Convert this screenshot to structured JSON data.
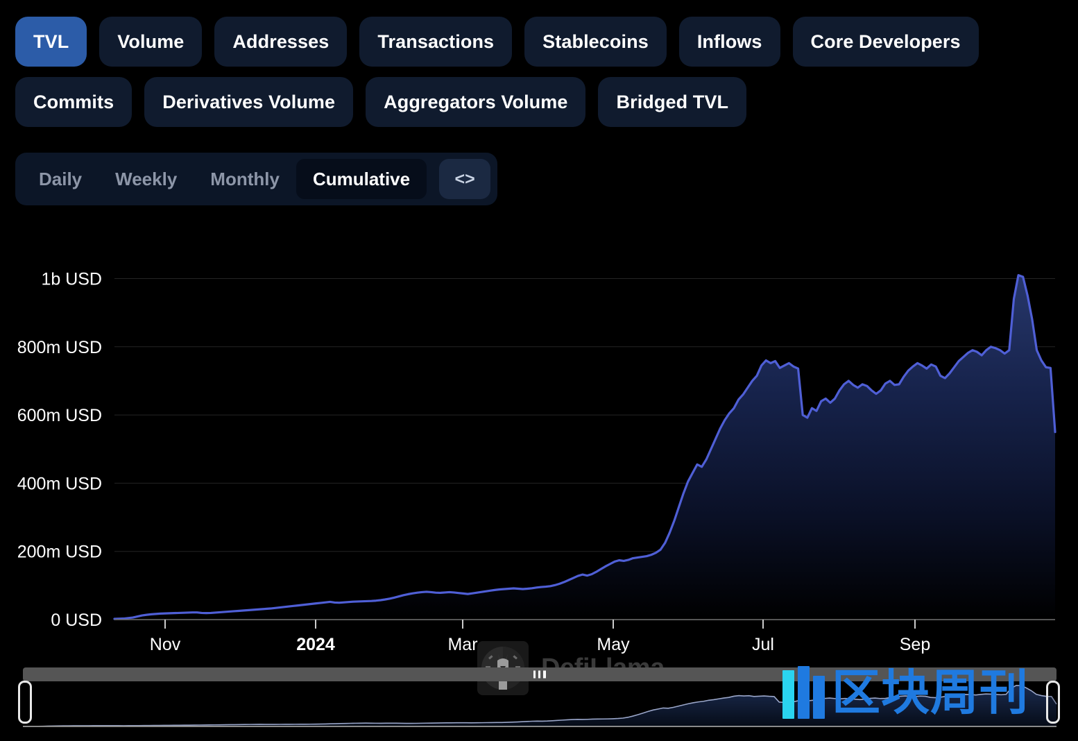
{
  "metric_tabs": {
    "row1": [
      {
        "label": "TVL",
        "active": true
      },
      {
        "label": "Volume",
        "active": false
      },
      {
        "label": "Addresses",
        "active": false
      },
      {
        "label": "Transactions",
        "active": false
      },
      {
        "label": "Stablecoins",
        "active": false
      },
      {
        "label": "Inflows",
        "active": false
      },
      {
        "label": "Core Developers",
        "active": false
      }
    ],
    "row2": [
      {
        "label": "Commits",
        "active": false
      },
      {
        "label": "Derivatives Volume",
        "active": false
      },
      {
        "label": "Aggregators Volume",
        "active": false
      },
      {
        "label": "Bridged TVL",
        "active": false
      }
    ],
    "active_color": "#2c5ca8",
    "inactive_color": "#101b2e"
  },
  "interval_selector": {
    "items": [
      {
        "label": "Daily",
        "active": false
      },
      {
        "label": "Weekly",
        "active": false
      },
      {
        "label": "Monthly",
        "active": false
      },
      {
        "label": "Cumulative",
        "active": true
      }
    ],
    "code_button_label": "<>",
    "code_button_icon": "code-brackets-icon"
  },
  "watermark": {
    "brand": "DefiLlama",
    "logo_icon": "llama-logo-icon",
    "color": "#3a3a3a"
  },
  "cn_watermark": {
    "text": "区块周刊",
    "bars_icon": "three-bars-icon",
    "color": "#1f7ae0",
    "accent_color": "#2ad4f0"
  },
  "brush": {
    "grip_icon": "drag-grip-icon",
    "left_handle_icon": "brush-handle-left-icon",
    "right_handle_icon": "brush-handle-right-icon",
    "bar_color": "#555555"
  },
  "chart_data": {
    "type": "area",
    "title": "",
    "xlabel": "",
    "ylabel": "",
    "line_color": "#4f5fd6",
    "fill_top_color": "#1b2a52",
    "fill_bottom_color": "#000000",
    "grid": true,
    "legend_position": "none",
    "ylim": [
      0,
      1060000000
    ],
    "y_ticks": [
      0,
      200000000,
      400000000,
      600000000,
      800000000,
      1000000000
    ],
    "y_tick_labels": [
      "0 USD",
      "200m USD",
      "400m USD",
      "600m USD",
      "800m USD",
      "1b USD"
    ],
    "x_tick_labels": [
      "Nov",
      "2024",
      "Mar",
      "May",
      "Jul",
      "Sep"
    ],
    "x_tick_bold": [
      "2024"
    ],
    "x_range": [
      "2023-10-01",
      "2024-10-20"
    ],
    "series": [
      {
        "name": "TVL",
        "units": "USD",
        "points": [
          [
            0,
            2000000
          ],
          [
            1,
            2500000
          ],
          [
            2,
            3000000
          ],
          [
            3,
            4500000
          ],
          [
            4,
            6000000
          ],
          [
            5,
            9000000
          ],
          [
            6,
            12000000
          ],
          [
            7,
            14000000
          ],
          [
            8,
            15500000
          ],
          [
            9,
            16500000
          ],
          [
            10,
            17500000
          ],
          [
            11,
            18000000
          ],
          [
            12,
            18500000
          ],
          [
            13,
            19000000
          ],
          [
            14,
            19500000
          ],
          [
            15,
            20000000
          ],
          [
            16,
            20500000
          ],
          [
            17,
            21000000
          ],
          [
            18,
            21000000
          ],
          [
            19,
            19500000
          ],
          [
            20,
            19000000
          ],
          [
            21,
            19500000
          ],
          [
            22,
            20500000
          ],
          [
            23,
            21500000
          ],
          [
            24,
            22500000
          ],
          [
            25,
            23500000
          ],
          [
            26,
            24500000
          ],
          [
            27,
            25500000
          ],
          [
            28,
            26500000
          ],
          [
            29,
            27500000
          ],
          [
            30,
            28500000
          ],
          [
            31,
            29500000
          ],
          [
            32,
            30500000
          ],
          [
            33,
            31500000
          ],
          [
            34,
            32500000
          ],
          [
            35,
            34000000
          ],
          [
            36,
            35500000
          ],
          [
            37,
            37000000
          ],
          [
            38,
            38500000
          ],
          [
            39,
            40000000
          ],
          [
            40,
            41500000
          ],
          [
            41,
            43000000
          ],
          [
            42,
            44500000
          ],
          [
            43,
            46000000
          ],
          [
            44,
            47500000
          ],
          [
            45,
            49000000
          ],
          [
            46,
            50500000
          ],
          [
            47,
            52000000
          ],
          [
            48,
            50000000
          ],
          [
            49,
            49500000
          ],
          [
            50,
            50500000
          ],
          [
            51,
            51500000
          ],
          [
            52,
            52500000
          ],
          [
            53,
            53000000
          ],
          [
            54,
            53500000
          ],
          [
            55,
            54000000
          ],
          [
            56,
            54500000
          ],
          [
            57,
            55500000
          ],
          [
            58,
            57000000
          ],
          [
            59,
            59000000
          ],
          [
            60,
            61500000
          ],
          [
            61,
            64500000
          ],
          [
            62,
            68000000
          ],
          [
            63,
            71500000
          ],
          [
            64,
            74500000
          ],
          [
            65,
            77000000
          ],
          [
            66,
            79000000
          ],
          [
            67,
            80500000
          ],
          [
            68,
            81500000
          ],
          [
            69,
            80500000
          ],
          [
            70,
            79000000
          ],
          [
            71,
            78500000
          ],
          [
            72,
            79500000
          ],
          [
            73,
            80500000
          ],
          [
            74,
            79500000
          ],
          [
            75,
            78000000
          ],
          [
            76,
            76500000
          ],
          [
            77,
            75000000
          ],
          [
            78,
            77000000
          ],
          [
            79,
            79000000
          ],
          [
            80,
            81000000
          ],
          [
            81,
            83000000
          ],
          [
            82,
            85000000
          ],
          [
            83,
            87000000
          ],
          [
            84,
            88500000
          ],
          [
            85,
            89500000
          ],
          [
            86,
            90500000
          ],
          [
            87,
            91500000
          ],
          [
            88,
            90500000
          ],
          [
            89,
            89500000
          ],
          [
            90,
            90500000
          ],
          [
            91,
            92000000
          ],
          [
            92,
            94000000
          ],
          [
            93,
            95500000
          ],
          [
            94,
            96500000
          ],
          [
            95,
            98000000
          ],
          [
            96,
            101000000
          ],
          [
            97,
            105000000
          ],
          [
            98,
            110000000
          ],
          [
            99,
            116000000
          ],
          [
            100,
            122000000
          ],
          [
            101,
            128000000
          ],
          [
            102,
            132000000
          ],
          [
            103,
            129000000
          ],
          [
            104,
            133000000
          ],
          [
            105,
            140000000
          ],
          [
            106,
            148000000
          ],
          [
            107,
            156000000
          ],
          [
            108,
            163000000
          ],
          [
            109,
            170000000
          ],
          [
            110,
            174000000
          ],
          [
            111,
            172000000
          ],
          [
            112,
            175000000
          ],
          [
            113,
            180000000
          ],
          [
            114,
            182000000
          ],
          [
            115,
            184000000
          ],
          [
            116,
            186000000
          ],
          [
            117,
            190000000
          ],
          [
            118,
            196000000
          ],
          [
            119,
            205000000
          ],
          [
            120,
            225000000
          ],
          [
            121,
            255000000
          ],
          [
            122,
            290000000
          ],
          [
            123,
            330000000
          ],
          [
            124,
            370000000
          ],
          [
            125,
            405000000
          ],
          [
            126,
            430000000
          ],
          [
            127,
            455000000
          ],
          [
            128,
            448000000
          ],
          [
            129,
            470000000
          ],
          [
            130,
            500000000
          ],
          [
            131,
            530000000
          ],
          [
            132,
            560000000
          ],
          [
            133,
            585000000
          ],
          [
            134,
            605000000
          ],
          [
            135,
            620000000
          ],
          [
            136,
            645000000
          ],
          [
            137,
            660000000
          ],
          [
            138,
            680000000
          ],
          [
            139,
            700000000
          ],
          [
            140,
            715000000
          ],
          [
            141,
            745000000
          ],
          [
            142,
            760000000
          ],
          [
            143,
            752000000
          ],
          [
            144,
            758000000
          ],
          [
            145,
            738000000
          ],
          [
            146,
            745000000
          ],
          [
            147,
            752000000
          ],
          [
            148,
            742000000
          ],
          [
            149,
            736000000
          ],
          [
            150,
            600000000
          ],
          [
            151,
            592000000
          ],
          [
            152,
            620000000
          ],
          [
            153,
            612000000
          ],
          [
            154,
            640000000
          ],
          [
            155,
            648000000
          ],
          [
            156,
            636000000
          ],
          [
            157,
            648000000
          ],
          [
            158,
            672000000
          ],
          [
            159,
            690000000
          ],
          [
            160,
            700000000
          ],
          [
            161,
            688000000
          ],
          [
            162,
            680000000
          ],
          [
            163,
            690000000
          ],
          [
            164,
            685000000
          ],
          [
            165,
            672000000
          ],
          [
            166,
            662000000
          ],
          [
            167,
            672000000
          ],
          [
            168,
            692000000
          ],
          [
            169,
            700000000
          ],
          [
            170,
            688000000
          ],
          [
            171,
            690000000
          ],
          [
            172,
            712000000
          ],
          [
            173,
            730000000
          ],
          [
            174,
            742000000
          ],
          [
            175,
            752000000
          ],
          [
            176,
            745000000
          ],
          [
            177,
            736000000
          ],
          [
            178,
            748000000
          ],
          [
            179,
            742000000
          ],
          [
            180,
            715000000
          ],
          [
            181,
            708000000
          ],
          [
            182,
            722000000
          ],
          [
            183,
            740000000
          ],
          [
            184,
            758000000
          ],
          [
            185,
            770000000
          ],
          [
            186,
            782000000
          ],
          [
            187,
            790000000
          ],
          [
            188,
            785000000
          ],
          [
            189,
            775000000
          ],
          [
            190,
            790000000
          ],
          [
            191,
            800000000
          ],
          [
            192,
            796000000
          ],
          [
            193,
            790000000
          ],
          [
            194,
            780000000
          ],
          [
            195,
            790000000
          ],
          [
            196,
            940000000
          ],
          [
            197,
            1010000000
          ],
          [
            198,
            1005000000
          ],
          [
            199,
            950000000
          ],
          [
            200,
            880000000
          ],
          [
            201,
            790000000
          ],
          [
            202,
            760000000
          ],
          [
            203,
            740000000
          ],
          [
            204,
            738000000
          ],
          [
            205,
            550000000
          ]
        ],
        "peak_value": 1010000000,
        "peak_label": "1.01b USD",
        "last_value": 550000000
      }
    ]
  }
}
